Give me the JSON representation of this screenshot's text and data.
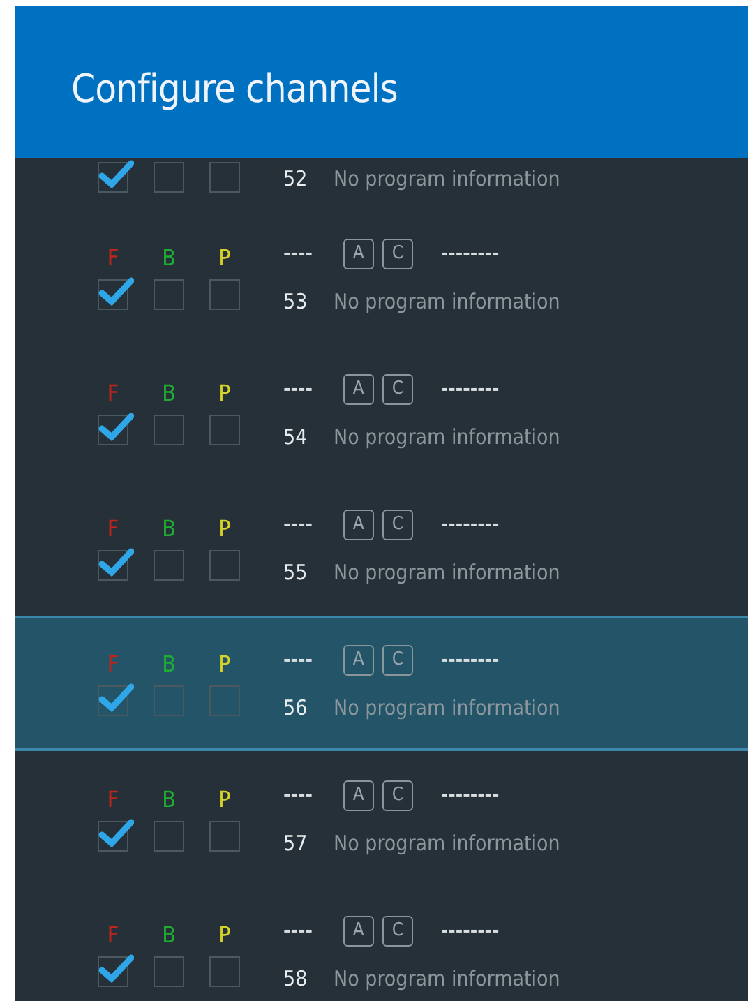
{
  "header": {
    "title": "Configure channels"
  },
  "rows": [
    {
      "kind": "partial",
      "flags": [
        {
          "checked": true
        },
        {
          "checked": false
        },
        {
          "checked": false
        }
      ],
      "number": "52",
      "info": "No program information"
    },
    {
      "kind": "full",
      "selected": false,
      "flags": [
        {
          "label": "F",
          "color": "#c0241b",
          "checked": true
        },
        {
          "label": "B",
          "color": "#1fae32",
          "checked": false
        },
        {
          "label": "P",
          "color": "#d6d22a",
          "checked": false
        }
      ],
      "name": "----",
      "badges": [
        "A",
        "C"
      ],
      "program": "--------",
      "number": "53",
      "info": "No program information"
    },
    {
      "kind": "full",
      "selected": false,
      "flags": [
        {
          "label": "F",
          "color": "#c0241b",
          "checked": true
        },
        {
          "label": "B",
          "color": "#1fae32",
          "checked": false
        },
        {
          "label": "P",
          "color": "#d6d22a",
          "checked": false
        }
      ],
      "name": "----",
      "badges": [
        "A",
        "C"
      ],
      "program": "--------",
      "number": "54",
      "info": "No program information"
    },
    {
      "kind": "full",
      "selected": false,
      "flags": [
        {
          "label": "F",
          "color": "#c0241b",
          "checked": true
        },
        {
          "label": "B",
          "color": "#1fae32",
          "checked": false
        },
        {
          "label": "P",
          "color": "#d6d22a",
          "checked": false
        }
      ],
      "name": "----",
      "badges": [
        "A",
        "C"
      ],
      "program": "--------",
      "number": "55",
      "info": "No program information"
    },
    {
      "kind": "full",
      "selected": true,
      "flags": [
        {
          "label": "F",
          "color": "#c0241b",
          "checked": true
        },
        {
          "label": "B",
          "color": "#1fae32",
          "checked": false
        },
        {
          "label": "P",
          "color": "#d6d22a",
          "checked": false
        }
      ],
      "name": "----",
      "badges": [
        "A",
        "C"
      ],
      "program": "--------",
      "number": "56",
      "info": "No program information"
    },
    {
      "kind": "full",
      "selected": false,
      "flags": [
        {
          "label": "F",
          "color": "#c0241b",
          "checked": true
        },
        {
          "label": "B",
          "color": "#1fae32",
          "checked": false
        },
        {
          "label": "P",
          "color": "#d6d22a",
          "checked": false
        }
      ],
      "name": "----",
      "badges": [
        "A",
        "C"
      ],
      "program": "--------",
      "number": "57",
      "info": "No program information"
    },
    {
      "kind": "full",
      "selected": false,
      "flags": [
        {
          "label": "F",
          "color": "#c0241b",
          "checked": true
        },
        {
          "label": "B",
          "color": "#1fae32",
          "checked": false
        },
        {
          "label": "P",
          "color": "#d6d22a",
          "checked": false
        }
      ],
      "name": "----",
      "badges": [
        "A",
        "C"
      ],
      "program": "--------",
      "number": "58",
      "info": "No program information"
    }
  ]
}
